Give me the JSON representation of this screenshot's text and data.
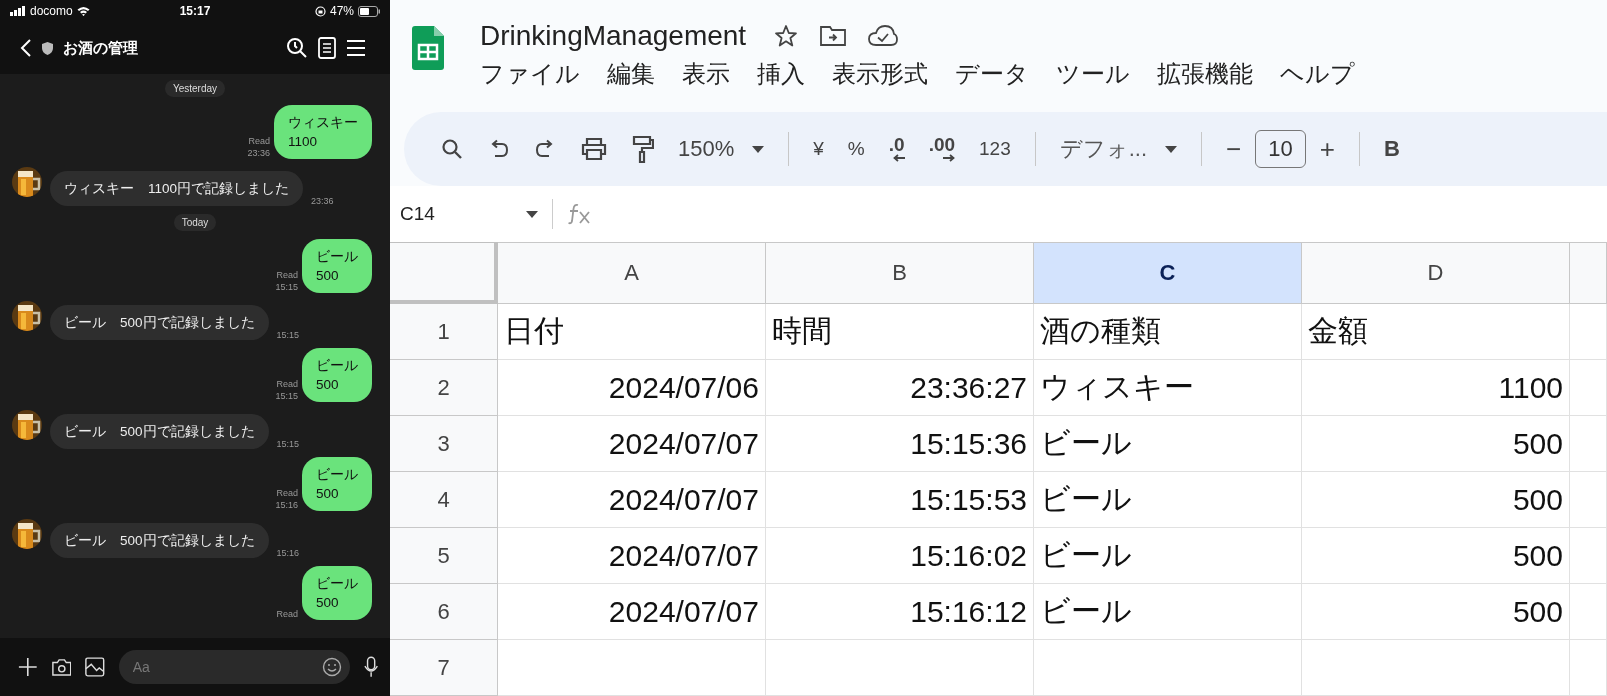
{
  "phone": {
    "status_bar": {
      "carrier": "docomo",
      "time": "15:17",
      "battery": "47%"
    },
    "chat_header": {
      "title": "お酒の管理"
    },
    "messages": [
      {
        "kind": "date",
        "text": "Yesterday"
      },
      {
        "kind": "sent",
        "text": "ウィスキー\n1100",
        "read": "Read",
        "time": "23:36"
      },
      {
        "kind": "received",
        "text": "ウィスキー　1100円で記録しました",
        "time": "23:36"
      },
      {
        "kind": "date",
        "text": "Today"
      },
      {
        "kind": "sent",
        "text": "ビール\n500",
        "read": "Read",
        "time": "15:15"
      },
      {
        "kind": "received",
        "text": "ビール　500円で記録しました",
        "time": "15:15"
      },
      {
        "kind": "sent",
        "text": "ビール\n500",
        "read": "Read",
        "time": "15:15"
      },
      {
        "kind": "received",
        "text": "ビール　500円で記録しました",
        "time": "15:15"
      },
      {
        "kind": "sent",
        "text": "ビール\n500",
        "read": "Read",
        "time": "15:16"
      },
      {
        "kind": "received",
        "text": "ビール　500円で記録しました",
        "time": "15:16"
      },
      {
        "kind": "sent",
        "text": "ビール\n500",
        "read": "Read"
      }
    ],
    "input": {
      "placeholder": "Aa"
    }
  },
  "sheet": {
    "title": "DrinkingManagement",
    "menu": [
      "ファイル",
      "編集",
      "表示",
      "挿入",
      "表示形式",
      "データ",
      "ツール",
      "拡張機能",
      "ヘルプ"
    ],
    "toolbar": {
      "zoom": "150%",
      "currency": "¥",
      "percent": "%",
      "decrease_decimal": ".0",
      "increase_decimal": ".00",
      "number_format": "123",
      "font": "デフォ...",
      "minus": "−",
      "font_size": "10",
      "plus": "+",
      "bold": "B"
    },
    "name_box": "C14",
    "columns": [
      {
        "label": "A",
        "selected": false
      },
      {
        "label": "B",
        "selected": false
      },
      {
        "label": "C",
        "selected": true
      },
      {
        "label": "D",
        "selected": false
      }
    ],
    "rows": [
      {
        "number": "1",
        "cells": [
          {
            "text": "日付",
            "kind": "text"
          },
          {
            "text": "時間",
            "kind": "text"
          },
          {
            "text": "酒の種類",
            "kind": "text"
          },
          {
            "text": "金額",
            "kind": "text"
          }
        ]
      },
      {
        "number": "2",
        "cells": [
          {
            "text": "2024/07/06",
            "kind": "number"
          },
          {
            "text": "23:36:27",
            "kind": "number"
          },
          {
            "text": "ウィスキー",
            "kind": "text"
          },
          {
            "text": "1100",
            "kind": "number"
          }
        ]
      },
      {
        "number": "3",
        "cells": [
          {
            "text": "2024/07/07",
            "kind": "number"
          },
          {
            "text": "15:15:36",
            "kind": "number"
          },
          {
            "text": "ビール",
            "kind": "text"
          },
          {
            "text": "500",
            "kind": "number"
          }
        ]
      },
      {
        "number": "4",
        "cells": [
          {
            "text": "2024/07/07",
            "kind": "number"
          },
          {
            "text": "15:15:53",
            "kind": "number"
          },
          {
            "text": "ビール",
            "kind": "text"
          },
          {
            "text": "500",
            "kind": "number"
          }
        ]
      },
      {
        "number": "5",
        "cells": [
          {
            "text": "2024/07/07",
            "kind": "number"
          },
          {
            "text": "15:16:02",
            "kind": "number"
          },
          {
            "text": "ビール",
            "kind": "text"
          },
          {
            "text": "500",
            "kind": "number"
          }
        ]
      },
      {
        "number": "6",
        "cells": [
          {
            "text": "2024/07/07",
            "kind": "number"
          },
          {
            "text": "15:16:12",
            "kind": "number"
          },
          {
            "text": "ビール",
            "kind": "text"
          },
          {
            "text": "500",
            "kind": "number"
          }
        ]
      },
      {
        "number": "7"
      }
    ]
  }
}
